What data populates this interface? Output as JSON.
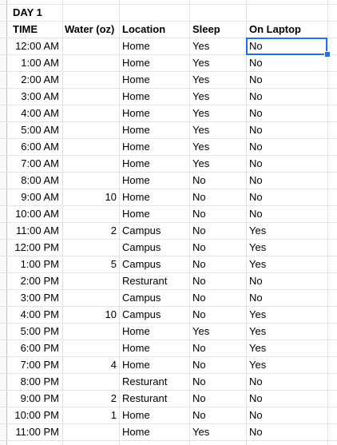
{
  "sheet": {
    "title": "DAY 1",
    "headers": {
      "time": "TIME",
      "water": "Water (oz)",
      "location": "Location",
      "sleep": "Sleep",
      "laptop": "On Laptop"
    },
    "selected_cell": "On Laptop, 12:00 AM",
    "rows": [
      {
        "time": "12:00 AM",
        "water": "",
        "location": "Home",
        "sleep": "Yes",
        "laptop": "No"
      },
      {
        "time": "1:00 AM",
        "water": "",
        "location": "Home",
        "sleep": "Yes",
        "laptop": "No"
      },
      {
        "time": "2:00 AM",
        "water": "",
        "location": "Home",
        "sleep": "Yes",
        "laptop": "No"
      },
      {
        "time": "3:00 AM",
        "water": "",
        "location": "Home",
        "sleep": "Yes",
        "laptop": "No"
      },
      {
        "time": "4:00 AM",
        "water": "",
        "location": "Home",
        "sleep": "Yes",
        "laptop": "No"
      },
      {
        "time": "5:00 AM",
        "water": "",
        "location": "Home",
        "sleep": "Yes",
        "laptop": "No"
      },
      {
        "time": "6:00 AM",
        "water": "",
        "location": "Home",
        "sleep": "Yes",
        "laptop": "No"
      },
      {
        "time": "7:00 AM",
        "water": "",
        "location": "Home",
        "sleep": "Yes",
        "laptop": "No"
      },
      {
        "time": "8:00 AM",
        "water": "",
        "location": "Home",
        "sleep": "No",
        "laptop": "No"
      },
      {
        "time": "9:00 AM",
        "water": "10",
        "location": "Home",
        "sleep": "No",
        "laptop": "No"
      },
      {
        "time": "10:00 AM",
        "water": "",
        "location": "Home",
        "sleep": "No",
        "laptop": "No"
      },
      {
        "time": "11:00 AM",
        "water": "2",
        "location": "Campus",
        "sleep": "No",
        "laptop": "Yes"
      },
      {
        "time": "12:00 PM",
        "water": "",
        "location": "Campus",
        "sleep": "No",
        "laptop": "Yes"
      },
      {
        "time": "1:00 PM",
        "water": "5",
        "location": "Campus",
        "sleep": "No",
        "laptop": "Yes"
      },
      {
        "time": "2:00 PM",
        "water": "",
        "location": "Resturant",
        "sleep": "No",
        "laptop": "No"
      },
      {
        "time": "3:00 PM",
        "water": "",
        "location": "Campus",
        "sleep": "No",
        "laptop": "No"
      },
      {
        "time": "4:00 PM",
        "water": "10",
        "location": "Campus",
        "sleep": "No",
        "laptop": "Yes"
      },
      {
        "time": "5:00 PM",
        "water": "",
        "location": "Home",
        "sleep": "Yes",
        "laptop": "Yes"
      },
      {
        "time": "6:00 PM",
        "water": "",
        "location": "Home",
        "sleep": "No",
        "laptop": "Yes"
      },
      {
        "time": "7:00 PM",
        "water": "4",
        "location": "Home",
        "sleep": "No",
        "laptop": "Yes"
      },
      {
        "time": "8:00 PM",
        "water": "",
        "location": "Resturant",
        "sleep": "No",
        "laptop": "No"
      },
      {
        "time": "9:00 PM",
        "water": "2",
        "location": "Resturant",
        "sleep": "No",
        "laptop": "No"
      },
      {
        "time": "10:00 PM",
        "water": "1",
        "location": "Home",
        "sleep": "No",
        "laptop": "No"
      },
      {
        "time": "11:00 PM",
        "water": "",
        "location": "Home",
        "sleep": "Yes",
        "laptop": "No"
      }
    ]
  },
  "colors": {
    "gridline": "#e2e2e2",
    "selection": "#1a73e8",
    "row_header": "#f8f9fa"
  }
}
